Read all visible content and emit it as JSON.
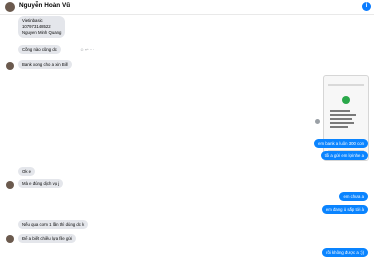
{
  "header": {
    "contact_name": "Nguyễn Hoàn Vũ",
    "chevron": "›",
    "info_icon": "i"
  },
  "messages": {
    "m1": [
      "Vietinbasic",
      "107973148522",
      "Nguyen Minh Quang"
    ],
    "m2": "Cồng nào cũng dc",
    "m3": "Bank xong cho a xin Bill",
    "m4": "em bank a luôn 300 con",
    "m5": "tối a gửi em lợinhe a",
    "m6": "Ok e",
    "m7": "Mà e đúng dịch vụ j",
    "m8": "em chưa a",
    "m9": "em đang ủ sắp tới à",
    "m10": "Nếu qua cơm 1 lần thì dùng dc k",
    "m11": "Để a biết chiều lựa file gửi",
    "m12": "rồi không được a :))"
  },
  "colors": {
    "outgoing": "#0a84ff",
    "incoming": "#e4e6eb",
    "accent": "#0a7cff"
  }
}
